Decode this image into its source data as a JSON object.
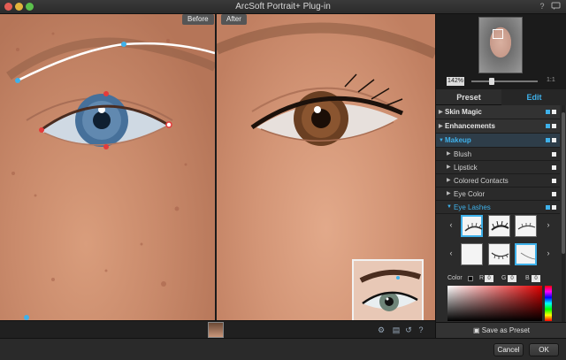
{
  "window": {
    "title": "ArcSoft Portrait+ Plug-in",
    "help_icon": "question-icon",
    "chat_icon": "chat-icon"
  },
  "canvas": {
    "before_label": "Before",
    "after_label": "After"
  },
  "navigator": {
    "zoom_label": "142%",
    "fit_label": "1:1"
  },
  "tabs": {
    "preset": "Preset",
    "edit": "Edit"
  },
  "menu": {
    "skin_magic": "Skin Magic",
    "enhancements": "Enhancements",
    "makeup": "Makeup",
    "blush": "Blush",
    "lipstick": "Lipstick",
    "colored_contacts": "Colored Contacts",
    "eye_color": "Eye Color",
    "eye_lashes": "Eye Lashes"
  },
  "color": {
    "label": "Color",
    "r_label": "R",
    "r_value": "0",
    "g_label": "G",
    "g_value": "0",
    "b_label": "B",
    "b_value": "0",
    "swatch": "#000000"
  },
  "buttons": {
    "save_as_preset": "Save as Preset",
    "cancel": "Cancel",
    "ok": "OK"
  },
  "colors": {
    "accent": "#3fb1ea",
    "control_point": "#3fb1ea",
    "lid_point": "#e53b3b"
  }
}
